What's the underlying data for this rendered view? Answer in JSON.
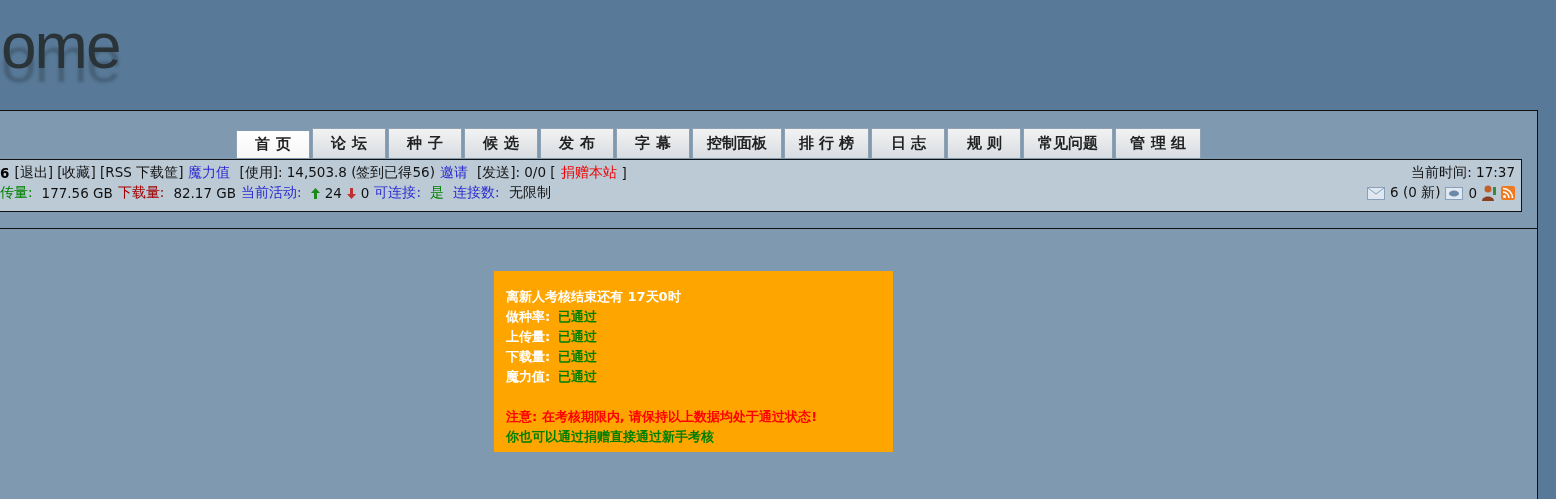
{
  "logo": {
    "text": "ome"
  },
  "tabs": [
    {
      "label": "首 页",
      "selected": true
    },
    {
      "label": "论 坛",
      "selected": false
    },
    {
      "label": "种 子",
      "selected": false
    },
    {
      "label": "候 选",
      "selected": false
    },
    {
      "label": "发 布",
      "selected": false
    },
    {
      "label": "字 幕",
      "selected": false
    },
    {
      "label": "控制面板",
      "selected": false
    },
    {
      "label": "排 行 榜",
      "selected": false
    },
    {
      "label": "日 志",
      "selected": false
    },
    {
      "label": "规 则",
      "selected": false
    },
    {
      "label": "常见问题",
      "selected": false
    },
    {
      "label": "管 理 组",
      "selected": false
    }
  ],
  "info_bar": {
    "line_1": [
      {
        "kind": "bold",
        "text": "6"
      },
      {
        "kind": "plain",
        "text": "[退出] [收藏] [RSS 下载筐]"
      },
      {
        "kind": "link",
        "text": "魔力值"
      },
      {
        "kind": "plain",
        "text": "[使用]: 14,503.8 (签到已得56)"
      },
      {
        "kind": "link",
        "text": "邀请"
      },
      {
        "kind": "plain",
        "text": "[发送]: 0/0 ["
      },
      {
        "kind": "alert",
        "text": "捐赠本站"
      },
      {
        "kind": "plain",
        "text": "]"
      }
    ],
    "line_2": [
      {
        "kind": "good",
        "text": "传量:"
      },
      {
        "kind": "plain",
        "text": "177.56 GB"
      },
      {
        "kind": "bad",
        "text": "下载量:"
      },
      {
        "kind": "plain",
        "text": "82.17 GB"
      },
      {
        "kind": "link",
        "text": "当前活动:"
      },
      {
        "kind": "up",
        "text": "24"
      },
      {
        "kind": "down",
        "text": "0"
      },
      {
        "kind": "link",
        "text": "可连接:"
      },
      {
        "kind": "good",
        "text": "是"
      },
      {
        "kind": "link",
        "text": "连接数:"
      },
      {
        "kind": "plain",
        "text": "无限制"
      }
    ],
    "time": "当前时间: 17:37",
    "messages": "6 (0 新)",
    "sent_messages": "0"
  },
  "notice": {
    "title": "离新人考核结束还有 17天0时",
    "checks": [
      {
        "label": "做种率:",
        "status": "已通过"
      },
      {
        "label": "上传量:",
        "status": "已通过"
      },
      {
        "label": "下载量:",
        "status": "已通过"
      },
      {
        "label": "魔力值:",
        "status": "已通过"
      }
    ],
    "warning": "注意: 在考核期限内, 请保持以上数据均处于通过状态!",
    "tip": "你也可以通过捐赠直接通过新手考核"
  }
}
